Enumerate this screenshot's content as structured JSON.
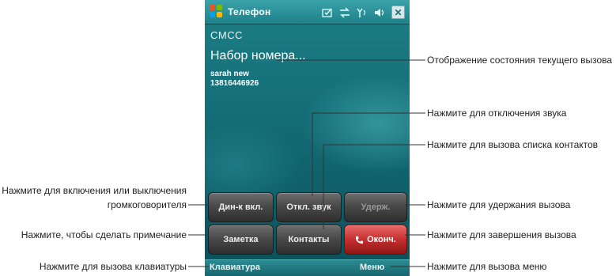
{
  "phone": {
    "title": "Телефон",
    "carrier": "CMCC",
    "call_state": "Набор номера...",
    "contact": {
      "name": "sarah new",
      "number": "13816446926"
    },
    "buttons": {
      "speaker": "Дин-к вкл.",
      "mute": "Откл. звук",
      "hold": "Удерж.",
      "note": "Заметка",
      "contacts": "Контакты",
      "end": "Оконч."
    },
    "softkeys": {
      "left": "Клавиатура",
      "right": "Меню"
    },
    "colors": {
      "screen": "#157079",
      "end_button": "#c42f2f",
      "buttons": "#4a4a4a"
    }
  },
  "callouts": {
    "call_status": "Отображение состояния текущего вызова",
    "mute": "Нажмите для отключения звука",
    "contacts": "Нажмите для вызова списка контактов",
    "speaker_line1": "Нажмите для включения или выключения",
    "speaker_line2": "громкоговорителя",
    "hold": "Нажмите для удержания вызова",
    "note": "Нажмите, чтобы сделать примечание",
    "end": "Нажмите для завершения вызова",
    "keypad": "Нажмите для вызова клавиатуры",
    "menu": "Нажмите для вызова меню"
  }
}
